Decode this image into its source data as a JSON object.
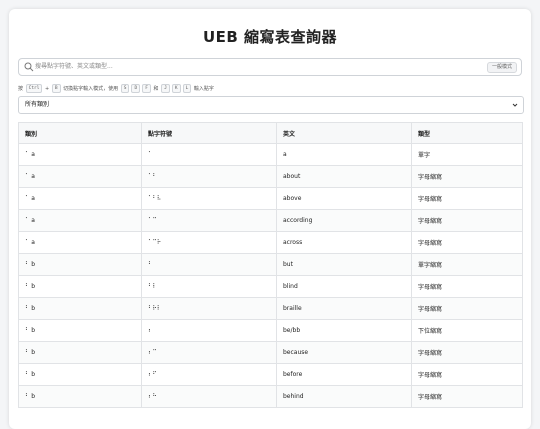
{
  "title": "UEB 縮寫表查詢器",
  "search": {
    "placeholder": "搜尋點字符號、英文或類型...",
    "mode_button": "一般模式"
  },
  "hint": {
    "pre": "按",
    "key_ctrl": "Ctrl",
    "plus": "+",
    "key_b": "B",
    "mid1": "切換點字輸入模式，使用",
    "keys_left": [
      "S",
      "D",
      "F"
    ],
    "and": "和",
    "keys_right": [
      "J",
      "K",
      "L"
    ],
    "post": "輸入點字"
  },
  "filter": {
    "selected": "所有類別"
  },
  "table": {
    "headers": [
      "類別",
      "點字符號",
      "英文",
      "類型"
    ],
    "rows": [
      {
        "category": "⠁ a",
        "braille": "⠁",
        "english": "a",
        "type": "單字"
      },
      {
        "category": "⠁ a",
        "braille": "⠁⠃",
        "english": "about",
        "type": "字母縮寫"
      },
      {
        "category": "⠁ a",
        "braille": "⠁⠃⠧",
        "english": "above",
        "type": "字母縮寫"
      },
      {
        "category": "⠁ a",
        "braille": "⠁⠉",
        "english": "according",
        "type": "字母縮寫"
      },
      {
        "category": "⠁ a",
        "braille": "⠁⠉⠗",
        "english": "across",
        "type": "字母縮寫"
      },
      {
        "category": "⠃ b",
        "braille": "⠃",
        "english": "but",
        "type": "單字縮寫"
      },
      {
        "category": "⠃ b",
        "braille": "⠃⠇",
        "english": "blind",
        "type": "字母縮寫"
      },
      {
        "category": "⠃ b",
        "braille": "⠃⠗⠇",
        "english": "braille",
        "type": "字母縮寫"
      },
      {
        "category": "⠃ b",
        "braille": "⠆",
        "english": "be/bb",
        "type": "下位縮寫"
      },
      {
        "category": "⠃ b",
        "braille": "⠆⠉",
        "english": "because",
        "type": "字母縮寫"
      },
      {
        "category": "⠃ b",
        "braille": "⠆⠋",
        "english": "before",
        "type": "字母縮寫"
      },
      {
        "category": "⠃ b",
        "braille": "⠆⠓",
        "english": "behind",
        "type": "字母縮寫"
      }
    ]
  },
  "colors": {
    "page_bg": "#f4f5f7",
    "card_bg": "#ffffff",
    "border": "#e1e3e6"
  }
}
